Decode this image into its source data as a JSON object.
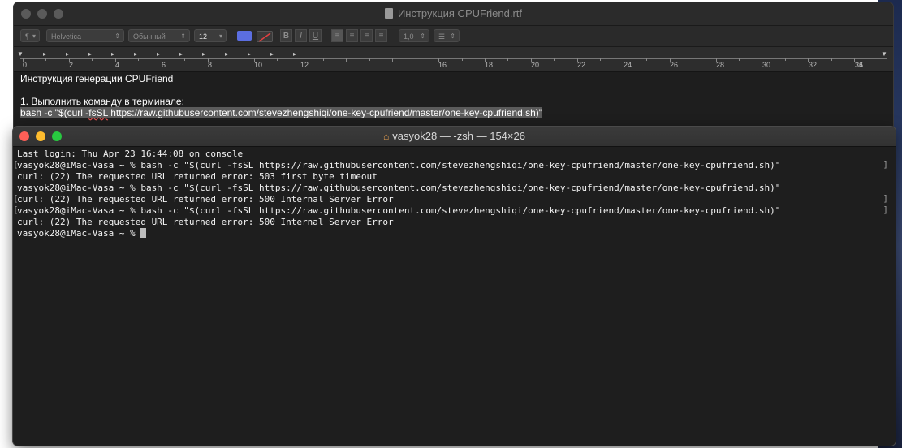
{
  "textedit": {
    "title": "Инструкция CPUFriend.rtf",
    "toolbar": {
      "paragraph_style": "¶",
      "font_family": "Helvetica",
      "font_style": "Обычный",
      "font_size": "12",
      "text_color": "#5b6ee1",
      "bold": "B",
      "italic": "I",
      "underline": "U",
      "line_spacing": "1,0",
      "list_style": "☰"
    },
    "ruler_numbers": [
      "0",
      "2",
      "4",
      "6",
      "8",
      "10",
      "12",
      "16",
      "18",
      "20",
      "22",
      "24",
      "26",
      "28",
      "30",
      "32",
      "34",
      "36"
    ],
    "content": {
      "heading": "Инструкция генерации CPUFriend",
      "step": "1. Выполнить команду в терминале:",
      "cmd_prefix": "bash -c \"$(curl -",
      "cmd_flag": "fsSL",
      "cmd_rest": " https://raw.githubusercontent.com/stevezhengshiqi/one-key-cpufriend/master/one-key-cpufriend.sh)\""
    }
  },
  "terminal": {
    "title": "vasyok28 — -zsh — 154×26",
    "lines": [
      "Last login: Thu Apr 23 16:44:08 on console",
      "vasyok28@iMac-Vasa ~ % bash -c \"$(curl -fsSL https://raw.githubusercontent.com/stevezhengshiqi/one-key-cpufriend/master/one-key-cpufriend.sh)\"",
      "curl: (22) The requested URL returned error: 503 first byte timeout",
      "vasyok28@iMac-Vasa ~ % bash -c \"$(curl -fsSL https://raw.githubusercontent.com/stevezhengshiqi/one-key-cpufriend/master/one-key-cpufriend.sh)\"",
      "curl: (22) The requested URL returned error: 500 Internal Server Error",
      "vasyok28@iMac-Vasa ~ % bash -c \"$(curl -fsSL https://raw.githubusercontent.com/stevezhengshiqi/one-key-cpufriend/master/one-key-cpufriend.sh)\"",
      "curl: (22) The requested URL returned error: 500 Internal Server Error"
    ],
    "prompt": "vasyok28@iMac-Vasa ~ % "
  }
}
